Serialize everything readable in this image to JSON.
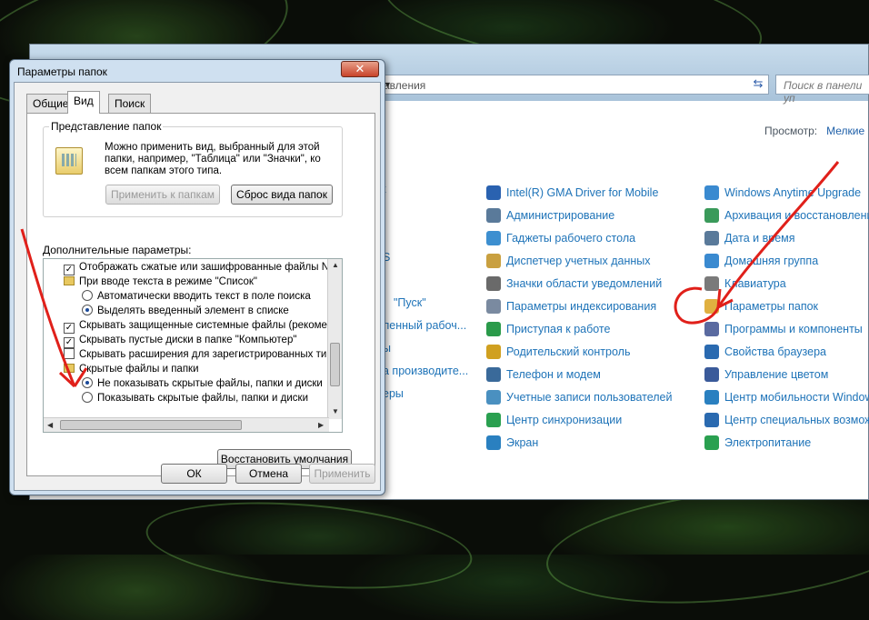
{
  "window": {
    "address_text": "авления",
    "search_placeholder": "Поиск в панели уп",
    "view_label": "Просмотр:",
    "view_value": "Мелкие"
  },
  "control_panel": {
    "left_fragments": [
      "t",
      "S",
      "\"Пуск\"",
      "ленный рабоч...",
      "",
      "а производите...",
      "ы",
      "еры"
    ],
    "col1": [
      "Intel(R) GMA Driver for Mobile",
      "Администрирование",
      "Гаджеты рабочего стола",
      "Диспетчер учетных данных",
      "Значки области уведомлений",
      "Параметры индексирования",
      "Приступая к работе",
      "Родительский контроль",
      "Телефон и модем",
      "Учетные записи пользователей",
      "Центр синхронизации",
      "Экран"
    ],
    "col2": [
      "Windows Anytime Upgrade",
      "Архивация и восстановление",
      "Дата и время",
      "Домашняя группа",
      "Клавиатура",
      "Параметры папок",
      "Программы и компоненты",
      "Свойства браузера",
      "Управление цветом",
      "Центр мобильности Windows",
      "Центр специальных возможн",
      "Электропитание"
    ]
  },
  "dialog": {
    "title": "Параметры папок",
    "close_glyph": "✕",
    "tabs": [
      "Общие",
      "Вид",
      "Поиск"
    ],
    "group_title": "Представление папок",
    "group_desc": "Можно применить вид, выбранный для этой папки, например, \"Таблица\" или \"Значки\", ко всем папкам этого типа.",
    "apply_folders": "Применить к папкам",
    "reset_folders": "Сброс вида папок",
    "advanced_label": "Дополнительные параметры:",
    "options": [
      {
        "kind": "checkbox",
        "checked": true,
        "text": "Отображать сжатые или зашифрованные файлы NTF"
      },
      {
        "kind": "folder",
        "text": "При вводе текста в режиме \"Список\""
      },
      {
        "kind": "radio",
        "checked": false,
        "text": "Автоматически вводить текст в поле поиска"
      },
      {
        "kind": "radio",
        "checked": true,
        "text": "Выделять введенный элемент в списке"
      },
      {
        "kind": "checkbox",
        "checked": true,
        "text": "Скрывать защищенные системные файлы (рекомен"
      },
      {
        "kind": "checkbox",
        "checked": true,
        "text": "Скрывать пустые диски в папке \"Компьютер\""
      },
      {
        "kind": "checkbox",
        "checked": false,
        "text": "Скрывать расширения для зарегистрированных типо"
      },
      {
        "kind": "folder",
        "text": "Скрытые файлы и папки"
      },
      {
        "kind": "radio",
        "checked": true,
        "text": "Не показывать скрытые файлы, папки и диски"
      },
      {
        "kind": "radio",
        "checked": false,
        "text": "Показывать скрытые файлы, папки и диски"
      }
    ],
    "restore_defaults": "Восстановить умолчания",
    "ok": "ОК",
    "cancel": "Отмена",
    "apply": "Применить"
  },
  "colors": {
    "link": "#1e73b8",
    "annotation": "#e0201a",
    "accent": "#1e5fa8"
  }
}
